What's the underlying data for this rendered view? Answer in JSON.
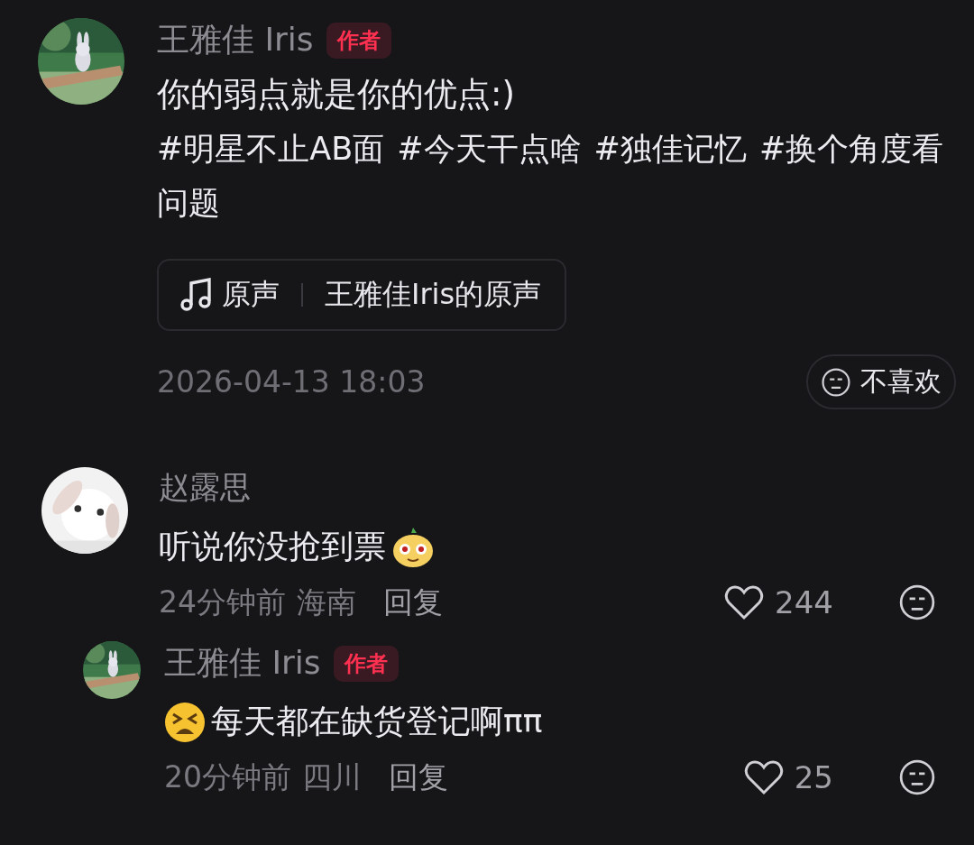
{
  "post": {
    "author": "王雅佳 Iris",
    "badge": "作者",
    "text": "你的弱点就是你的优点:)",
    "hashtags": [
      "#明星不止AB面",
      "#今天干点啥",
      "#独佳记忆",
      "#换个角度看问题"
    ],
    "music": {
      "label": "原声",
      "title": "王雅佳Iris的原声"
    },
    "date": "2026-04-13 18:03",
    "dislike": "不喜欢"
  },
  "comments": [
    {
      "author": "赵露思",
      "text": "听说你没抢到票",
      "emoji": {
        "kind": "mole"
      },
      "time": "24分钟前",
      "location": "海南",
      "reply": "回复",
      "likes": "244",
      "replies": [
        {
          "author": "王雅佳 Iris",
          "badge": "作者",
          "emoji": {
            "kind": "tired"
          },
          "text": "每天都在缺货登记啊ππ",
          "time": "20分钟前",
          "location": "四川",
          "reply": "回复",
          "likes": "25"
        }
      ]
    }
  ]
}
